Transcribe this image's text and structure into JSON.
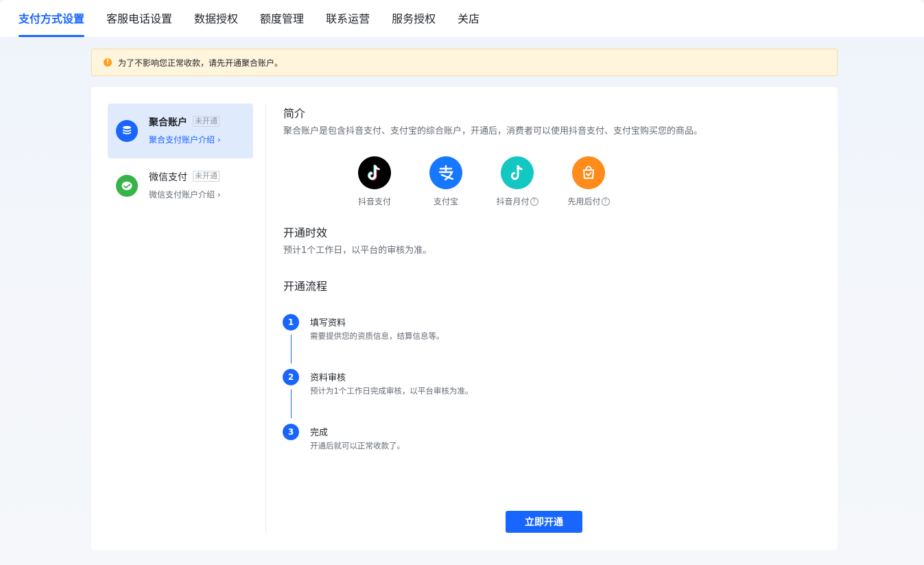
{
  "tabs": [
    {
      "label": "支付方式设置",
      "active": true
    },
    {
      "label": "客服电话设置"
    },
    {
      "label": "数据授权"
    },
    {
      "label": "额度管理"
    },
    {
      "label": "联系运营"
    },
    {
      "label": "服务授权"
    },
    {
      "label": "关店"
    }
  ],
  "alert": {
    "icon": "warning-icon",
    "text": "为了不影响您正常收款，请先开通聚合账户。"
  },
  "sidebar": {
    "items": [
      {
        "name": "聚合账户",
        "status": "未开通",
        "link": "聚合支付账户介绍 ›",
        "icon": "aggregate-account-icon",
        "color": "#1966ff"
      },
      {
        "name": "微信支付",
        "status": "未开通",
        "link": "微信支付账户介绍 ›",
        "icon": "wechat-pay-icon",
        "color": "#37b34a"
      }
    ]
  },
  "intro": {
    "title": "简介",
    "text": "聚合账户是包含抖音支付、支付宝的综合账户，开通后，消费者可以使用抖音支付、支付宝购买您的商品。"
  },
  "methods": [
    {
      "label": "抖音支付",
      "icon": "douyin-pay-icon",
      "color": "#000000",
      "help": false
    },
    {
      "label": "支付宝",
      "icon": "alipay-icon",
      "color": "#1677ff",
      "help": false
    },
    {
      "label": "抖音月付",
      "icon": "douyin-monthly-icon",
      "color": "#13c7c2",
      "help": true
    },
    {
      "label": "先用后付",
      "icon": "pay-later-icon",
      "color": "#ff8c1a",
      "help": true
    }
  ],
  "timing": {
    "title": "开通时效",
    "text": "预计1个工作日，以平台的审核为准。"
  },
  "process": {
    "title": "开通流程",
    "steps": [
      {
        "num": "1",
        "title": "填写资料",
        "desc": "需要提供您的资质信息，结算信息等。"
      },
      {
        "num": "2",
        "title": "资料审核",
        "desc": "预计为1个工作日完成审核，以平台审核为准。"
      },
      {
        "num": "3",
        "title": "完成",
        "desc": "开通后就可以正常收款了。"
      }
    ]
  },
  "action": {
    "label": "立即开通"
  }
}
